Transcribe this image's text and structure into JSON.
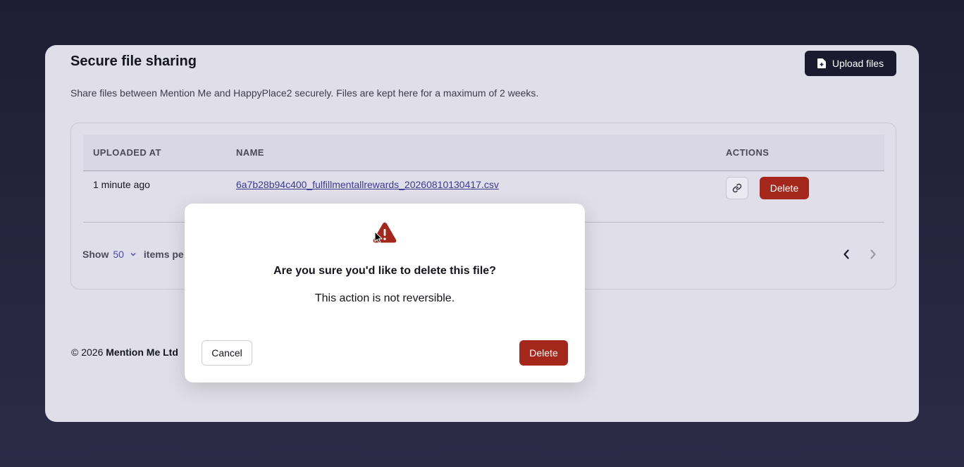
{
  "page": {
    "title": "Secure file sharing",
    "subtitle": "Share files between Mention Me and HappyPlace2 securely. Files are kept here for a maximum of 2 weeks.",
    "upload_label": "Upload files",
    "upload_icon": "file-plus-icon"
  },
  "table": {
    "columns": [
      "UPLOADED AT",
      "NAME",
      "ACTIONS"
    ],
    "rows": [
      {
        "uploaded_at": "1 minute ago",
        "name": "6a7b28b94c400_fulfillmentallrewards_20260810130417.csv",
        "copy_link_icon": "link-icon",
        "delete_label": "Delete"
      }
    ]
  },
  "pagination": {
    "show_label": "Show",
    "page_size": "50",
    "items_label": "items pe",
    "prev_icon": "chevron-left-icon",
    "next_icon": "chevron-right-icon"
  },
  "footer": {
    "copyright": "© 2026",
    "company": "Mention Me Ltd"
  },
  "modal": {
    "icon": "warning-triangle-icon",
    "title": "Are you sure you'd like to delete this file?",
    "body": "This action is not reversible.",
    "cancel_label": "Cancel",
    "confirm_label": "Delete"
  },
  "colors": {
    "danger": "#a5261b",
    "primary_dark": "#1b1b2f",
    "link": "#3a3a8f"
  }
}
